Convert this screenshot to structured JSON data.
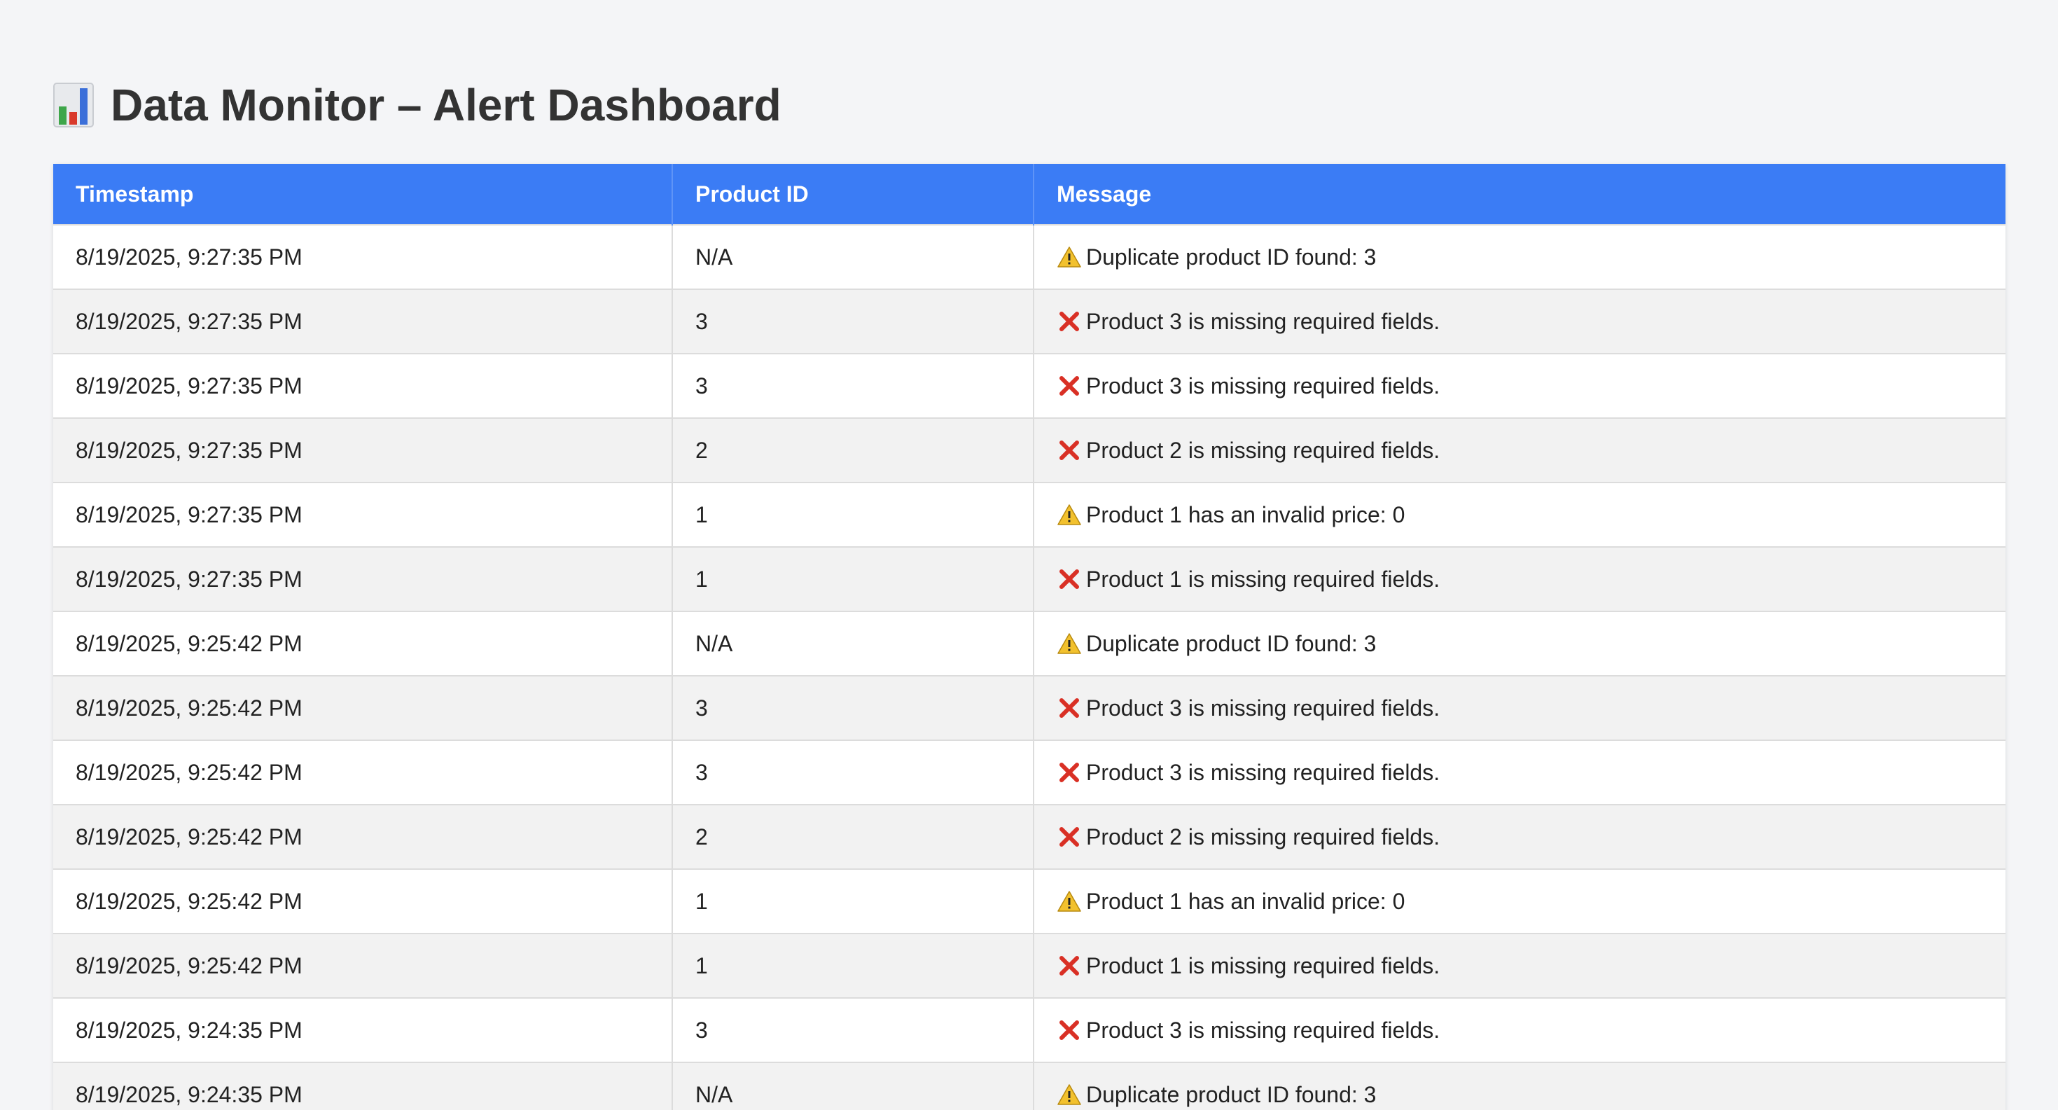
{
  "header": {
    "title": "Data Monitor – Alert Dashboard",
    "title_icon": "bar-chart-icon"
  },
  "table": {
    "columns": [
      "Timestamp",
      "Product ID",
      "Message"
    ],
    "rows": [
      {
        "timestamp": "8/19/2025, 9:27:35 PM",
        "product_id": "N/A",
        "icon": "warning-icon",
        "message": "Duplicate product ID found: 3"
      },
      {
        "timestamp": "8/19/2025, 9:27:35 PM",
        "product_id": "3",
        "icon": "error-x-icon",
        "message": "Product 3 is missing required fields."
      },
      {
        "timestamp": "8/19/2025, 9:27:35 PM",
        "product_id": "3",
        "icon": "error-x-icon",
        "message": "Product 3 is missing required fields."
      },
      {
        "timestamp": "8/19/2025, 9:27:35 PM",
        "product_id": "2",
        "icon": "error-x-icon",
        "message": "Product 2 is missing required fields."
      },
      {
        "timestamp": "8/19/2025, 9:27:35 PM",
        "product_id": "1",
        "icon": "warning-icon",
        "message": "Product 1 has an invalid price: 0"
      },
      {
        "timestamp": "8/19/2025, 9:27:35 PM",
        "product_id": "1",
        "icon": "error-x-icon",
        "message": "Product 1 is missing required fields."
      },
      {
        "timestamp": "8/19/2025, 9:25:42 PM",
        "product_id": "N/A",
        "icon": "warning-icon",
        "message": "Duplicate product ID found: 3"
      },
      {
        "timestamp": "8/19/2025, 9:25:42 PM",
        "product_id": "3",
        "icon": "error-x-icon",
        "message": "Product 3 is missing required fields."
      },
      {
        "timestamp": "8/19/2025, 9:25:42 PM",
        "product_id": "3",
        "icon": "error-x-icon",
        "message": "Product 3 is missing required fields."
      },
      {
        "timestamp": "8/19/2025, 9:25:42 PM",
        "product_id": "2",
        "icon": "error-x-icon",
        "message": "Product 2 is missing required fields."
      },
      {
        "timestamp": "8/19/2025, 9:25:42 PM",
        "product_id": "1",
        "icon": "warning-icon",
        "message": "Product 1 has an invalid price: 0"
      },
      {
        "timestamp": "8/19/2025, 9:25:42 PM",
        "product_id": "1",
        "icon": "error-x-icon",
        "message": "Product 1 is missing required fields."
      },
      {
        "timestamp": "8/19/2025, 9:24:35 PM",
        "product_id": "3",
        "icon": "error-x-icon",
        "message": "Product 3 is missing required fields."
      },
      {
        "timestamp": "8/19/2025, 9:24:35 PM",
        "product_id": "N/A",
        "icon": "warning-icon",
        "message": "Duplicate product ID found: 3"
      }
    ]
  },
  "colors": {
    "header_bg": "#3b7cf5",
    "page_bg": "#f4f5f7",
    "warning": "#f2c12e",
    "error": "#d93025"
  }
}
